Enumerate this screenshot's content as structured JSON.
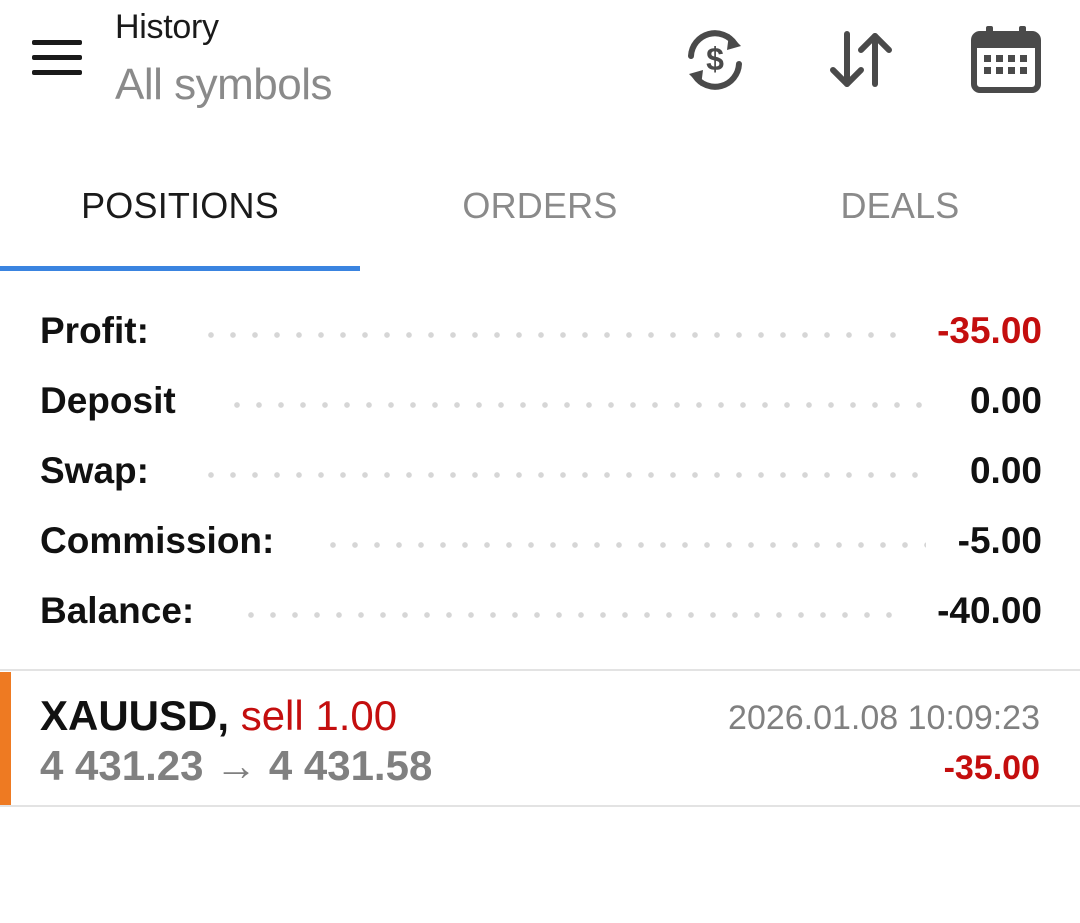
{
  "header": {
    "title": "History",
    "subtitle": "All symbols",
    "icons": [
      "menu-icon",
      "currency-exchange-icon",
      "sort-icon",
      "calendar-icon"
    ]
  },
  "tabs": [
    {
      "label": "POSITIONS",
      "active": true
    },
    {
      "label": "ORDERS",
      "active": false
    },
    {
      "label": "DEALS",
      "active": false
    }
  ],
  "summary": {
    "profit": {
      "label": "Profit:",
      "value": "-35.00"
    },
    "deposit": {
      "label": "Deposit",
      "value": "0.00"
    },
    "swap": {
      "label": "Swap:",
      "value": "0.00"
    },
    "commission": {
      "label": "Commission:",
      "value": "-5.00"
    },
    "balance": {
      "label": "Balance:",
      "value": "-40.00"
    }
  },
  "positions": [
    {
      "symbol": "XAUUSD,",
      "side": "sell 1.00",
      "prices": "4 431.23 → 4 431.58",
      "time": "2026.01.08 10:09:23",
      "profit": "-35.00"
    }
  ],
  "colors": {
    "accent": "#3a84e0",
    "negative": "#c40e0e",
    "sell_marker": "#ee7a22",
    "muted": "#8a8a8a"
  }
}
